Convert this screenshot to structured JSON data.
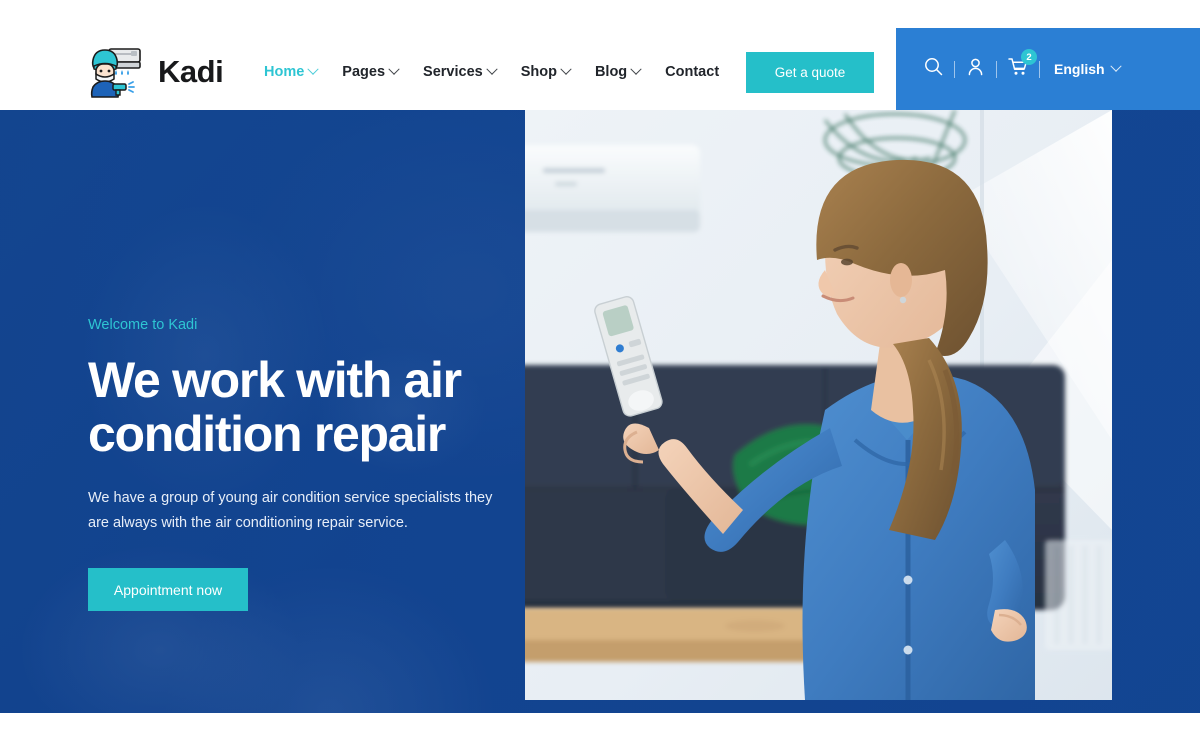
{
  "brand": {
    "name": "Kadi",
    "logo_icon": "technician-ac-logo-icon"
  },
  "nav": {
    "items": [
      {
        "label": "Home",
        "has_dropdown": true,
        "active": true
      },
      {
        "label": "Pages",
        "has_dropdown": true,
        "active": false
      },
      {
        "label": "Services",
        "has_dropdown": true,
        "active": false
      },
      {
        "label": "Shop",
        "has_dropdown": true,
        "active": false
      },
      {
        "label": "Blog",
        "has_dropdown": true,
        "active": false
      },
      {
        "label": "Contact",
        "has_dropdown": false,
        "active": false
      }
    ]
  },
  "header": {
    "quote_button": "Get a quote",
    "search_icon": "search-icon",
    "account_icon": "user-icon",
    "cart_icon": "cart-icon",
    "cart_count": "2",
    "language": "English"
  },
  "hero": {
    "eyebrow": "Welcome to Kadi",
    "title_line1": "We work with air",
    "title_line2": "condition repair",
    "description": "We have a group of young air condition service specialists they are always with the air conditioning repair service.",
    "cta": "Appointment now",
    "image_alt": "woman-pointing-remote-at-air-conditioner"
  },
  "colors": {
    "accent_teal": "#25bfc9",
    "accent_cyan": "#2ec5d3",
    "brand_blue": "#2b7fd4",
    "hero_navy": "#154a9b",
    "text_dark": "#21252b",
    "white": "#ffffff"
  }
}
